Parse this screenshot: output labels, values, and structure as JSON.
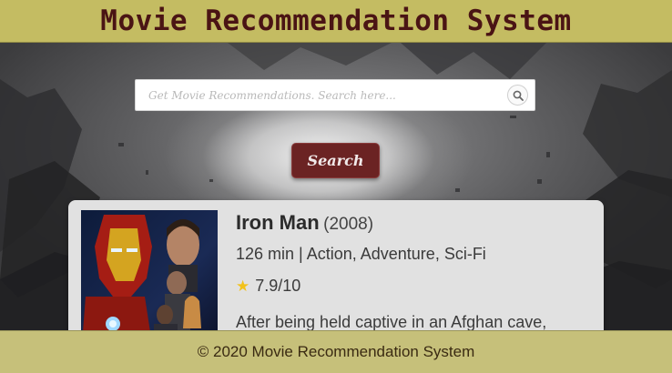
{
  "header": {
    "title": "Movie Recommendation System"
  },
  "search": {
    "placeholder": "Get Movie Recommendations. Search here...",
    "value": "",
    "icon": "search-icon",
    "button_label": "Search"
  },
  "movie": {
    "title": "Iron Man",
    "year": "(2008)",
    "meta": "126 min | Action, Adventure, Sci-Fi",
    "rating": "7.9/10",
    "rating_icon": "star-icon",
    "plot": "After being held captive in an Afghan cave,"
  },
  "footer": {
    "text": "© 2020 Movie Recommendation System"
  },
  "colors": {
    "header_bg": "#c4bc62",
    "title_text": "#4a1414",
    "search_button_bg": "#6b2323",
    "card_bg": "#e1e1e1",
    "footer_bg": "#c6c07a",
    "star": "#f2c21b"
  }
}
